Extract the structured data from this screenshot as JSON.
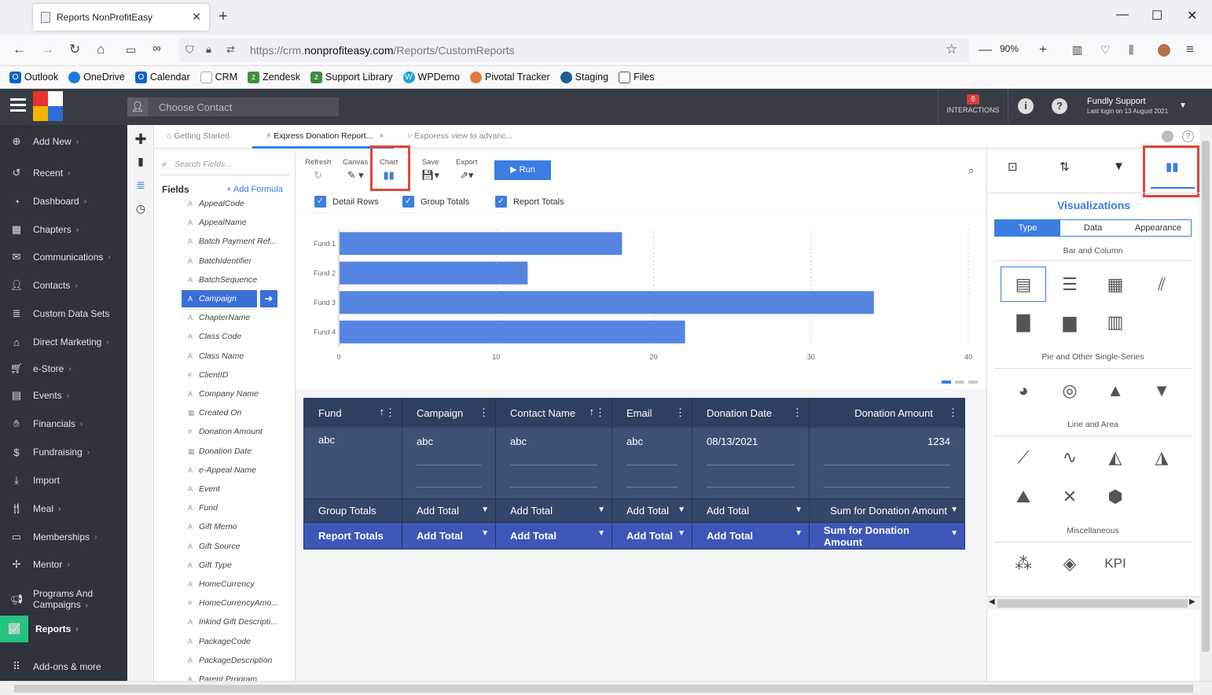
{
  "browser": {
    "tab_title": "Reports NonProfitEasy",
    "url_prefix": "https://crm.",
    "url_domain": "nonprofiteasy.com",
    "url_path": "/Reports/CustomReports",
    "zoom": "90%",
    "bookmarks": [
      "Outlook",
      "OneDrive",
      "Calendar",
      "CRM",
      "Zendesk",
      "Support Library",
      "WPDemo",
      "Pivotal Tracker",
      "Staging",
      "Files"
    ]
  },
  "header": {
    "contact_placeholder": "Choose Contact",
    "interactions_count": "6",
    "interactions_label": "INTERACTIONS",
    "user_name": "Fundly Support",
    "last_login": "Last login on 13 August 2021"
  },
  "sidebar": {
    "items": [
      "Add New",
      "Recent",
      "Dashboard",
      "Chapters",
      "Communications",
      "Contacts",
      "Custom Data Sets",
      "Direct Marketing",
      "e-Store",
      "Events",
      "Financials",
      "Fundraising",
      "Import",
      "Meal",
      "Memberships",
      "Mentor",
      "Programs And",
      "Reports",
      "Add-ons & more"
    ],
    "programs_line2": "Campaigns"
  },
  "doc_tabs": {
    "tab1": "Getting Started",
    "tab2": "Express Donation Report...",
    "tab3": "Exporess view to advanc..."
  },
  "fields": {
    "search_placeholder": "Search Fields...",
    "title": "Fields",
    "add_formula": "+ Add Formula",
    "list": [
      "AppealCode",
      "AppealName",
      "Batch Payment Ref...",
      "BatchIdentifier",
      "BatchSequence",
      "Campaign",
      "ChapterName",
      "Class Code",
      "Class Name",
      "ClientID",
      "Company Name",
      "Created On",
      "Donation Amount",
      "Donation Date",
      "e-Appeal Name",
      "Event",
      "Fund",
      "Gift Memo",
      "Gift Source",
      "Gift Type",
      "HomeCurrency",
      "HomeCurrencyAmo...",
      "Inkind Gift Descripti...",
      "PackageCode",
      "PackageDescription",
      "Parent Program"
    ],
    "types": [
      "A",
      "A",
      "A",
      "A",
      "A",
      "A",
      "A",
      "A",
      "A",
      "#",
      "A",
      "▦",
      "#",
      "▦",
      "A",
      "A",
      "A",
      "A",
      "A",
      "A",
      "A",
      "#",
      "A",
      "A",
      "A",
      "A"
    ]
  },
  "toolbar": {
    "refresh": "Refresh",
    "canvas": "Canvas",
    "chart": "Chart",
    "save": "Save",
    "export": "Export",
    "run": "Run"
  },
  "checks": {
    "detail_rows": "Detail Rows",
    "group_totals": "Group Totals",
    "report_totals": "Report Totals"
  },
  "chart_data": {
    "type": "bar",
    "orientation": "horizontal",
    "categories": [
      "Fund 1",
      "Fund 2",
      "Fund 3",
      "Fund 4"
    ],
    "values": [
      18,
      12,
      34,
      22
    ],
    "xlim": [
      0,
      40
    ],
    "xticks": [
      0,
      10,
      20,
      30,
      40
    ],
    "color": "#5585e0",
    "grid": true
  },
  "grid": {
    "columns": [
      "Fund",
      "Campaign",
      "Contact Name",
      "Email",
      "Donation Date",
      "Donation Amount"
    ],
    "row": [
      "abc",
      "abc",
      "abc",
      "abc",
      "08/13/2021",
      "1234"
    ],
    "group_totals_label": "Group Totals",
    "report_totals_label": "Report Totals",
    "add_total": "Add Total",
    "sum_label": "Sum for Donation Amount"
  },
  "right_panel": {
    "title": "Visualizations",
    "tabs": [
      "Type",
      "Data",
      "Appearance"
    ],
    "sections": [
      "Bar and Column",
      "Pie and Other Single-Series",
      "Line and Area",
      "Miscellaneous"
    ],
    "kpi": "KPI"
  },
  "colors": {
    "accent": "#3b7de0",
    "header_bg": "#383c44",
    "sidebar_bg": "#2f333b",
    "grid_header": "#2e3f5f",
    "highlight": "#e0463c"
  }
}
